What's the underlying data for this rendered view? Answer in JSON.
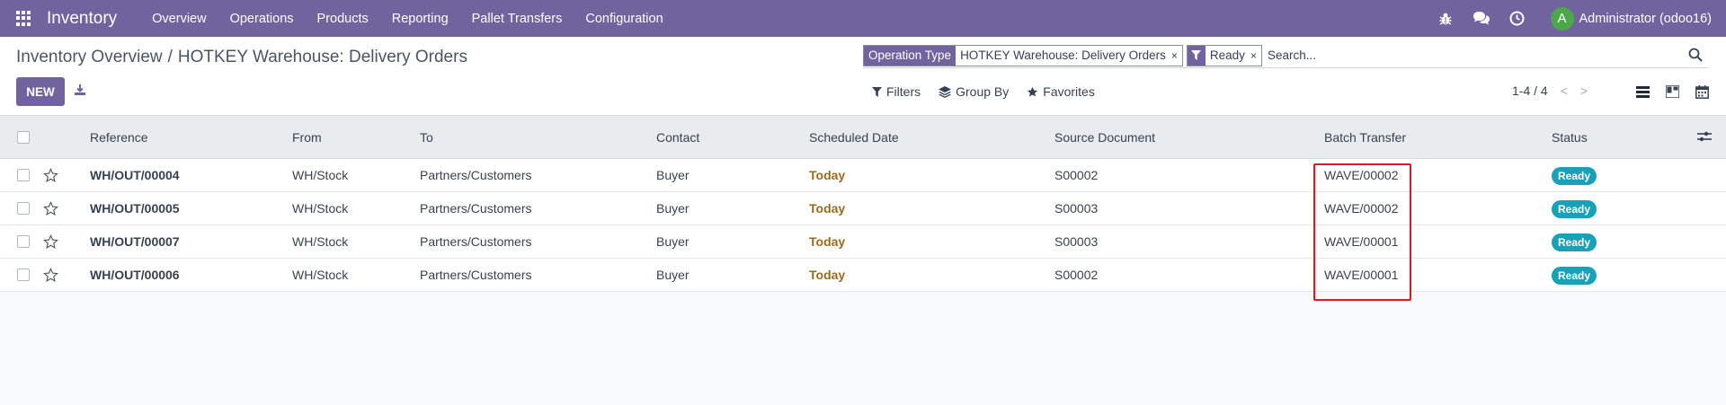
{
  "navbar": {
    "brand": "Inventory",
    "menu": [
      "Overview",
      "Operations",
      "Products",
      "Reporting",
      "Pallet Transfers",
      "Configuration"
    ],
    "user_initial": "A",
    "user_name": "Administrator (odoo16)",
    "icons": [
      "bug-icon",
      "chat-icon",
      "clock-icon"
    ]
  },
  "breadcrumb": {
    "parent": "Inventory Overview",
    "separator": "/",
    "current": "HOTKEY Warehouse: Delivery Orders"
  },
  "toolbar": {
    "new_label": "NEW"
  },
  "search": {
    "facets": [
      {
        "label": "Operation Type",
        "value": "HOTKEY Warehouse: Delivery Orders"
      },
      {
        "label": "",
        "value": "Ready"
      }
    ],
    "placeholder": "Search...",
    "close_glyph": "×"
  },
  "filters": {
    "filters_label": "Filters",
    "groupby_label": "Group By",
    "favorites_label": "Favorites"
  },
  "pager": {
    "value": "1-4 / 4",
    "prev": "<",
    "next": ">"
  },
  "table": {
    "columns": [
      "Reference",
      "From",
      "To",
      "Contact",
      "Scheduled Date",
      "Source Document",
      "Batch Transfer",
      "Status"
    ],
    "rows": [
      {
        "reference": "WH/OUT/00004",
        "from": "WH/Stock",
        "to": "Partners/Customers",
        "contact": "Buyer",
        "scheduled": "Today",
        "source": "S00002",
        "batch": "WAVE/00002",
        "status": "Ready"
      },
      {
        "reference": "WH/OUT/00005",
        "from": "WH/Stock",
        "to": "Partners/Customers",
        "contact": "Buyer",
        "scheduled": "Today",
        "source": "S00003",
        "batch": "WAVE/00002",
        "status": "Ready"
      },
      {
        "reference": "WH/OUT/00007",
        "from": "WH/Stock",
        "to": "Partners/Customers",
        "contact": "Buyer",
        "scheduled": "Today",
        "source": "S00003",
        "batch": "WAVE/00001",
        "status": "Ready"
      },
      {
        "reference": "WH/OUT/00006",
        "from": "WH/Stock",
        "to": "Partners/Customers",
        "contact": "Buyer",
        "scheduled": "Today",
        "source": "S00002",
        "batch": "WAVE/00001",
        "status": "Ready"
      }
    ]
  },
  "colors": {
    "brand": "#71639e",
    "status_ready": "#17a2b8",
    "today": "#9a6b1e",
    "highlight": "#e0191e"
  }
}
